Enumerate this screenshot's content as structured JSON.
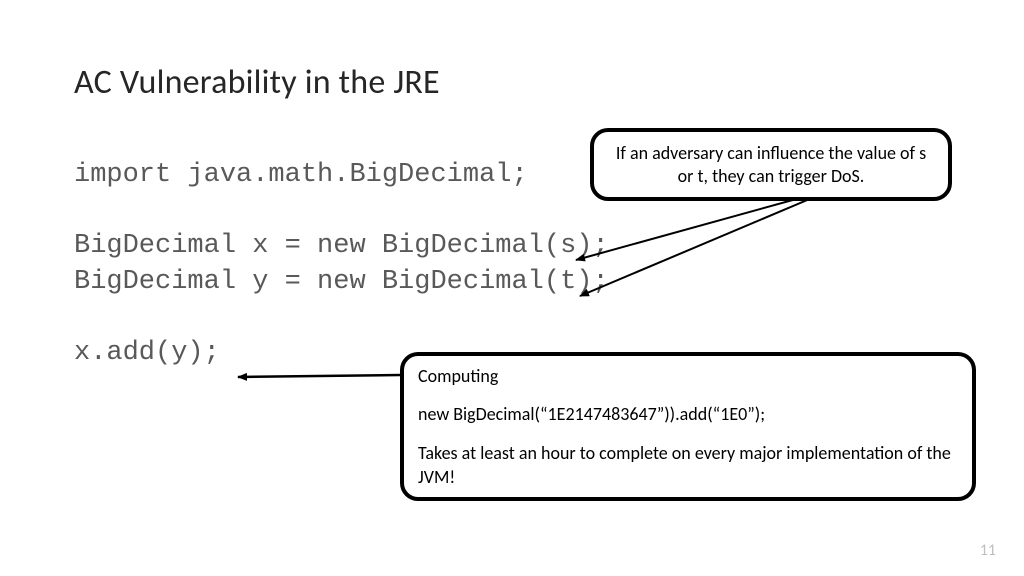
{
  "title": "AC Vulnerability in the JRE",
  "code": "import java.math.BigDecimal;\n\nBigDecimal x = new BigDecimal(s);\nBigDecimal y = new BigDecimal(t);\n\nx.add(y);",
  "callout_top": "If an adversary can influence the value of s or t, they can trigger DoS.",
  "callout_bottom": {
    "line1": "Computing",
    "line2": "new BigDecimal(“1E2147483647”)).add(“1E0”);",
    "line3": "Takes at least an hour to complete on every major implementation of the JVM!"
  },
  "page_number": "11"
}
